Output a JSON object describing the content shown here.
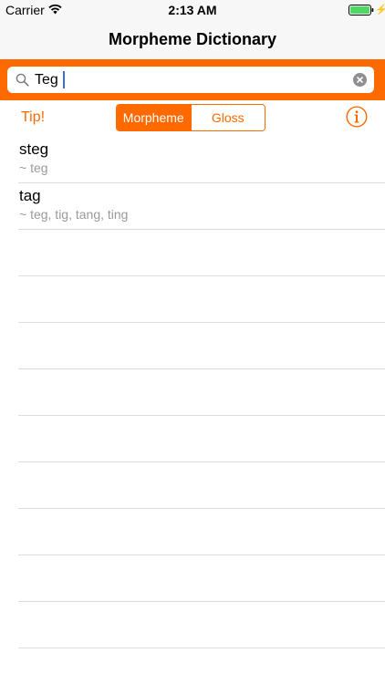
{
  "status_bar": {
    "carrier": "Carrier",
    "time": "2:13 AM",
    "battery_level": 1.0,
    "icons": [
      "wifi-icon",
      "battery-icon",
      "charging-icon"
    ]
  },
  "nav": {
    "title": "Morpheme Dictionary"
  },
  "search": {
    "value": "Teg",
    "icon": "search-icon",
    "clear_icon": "clear-icon"
  },
  "toolbar": {
    "tip_label": "Tip!",
    "segments": [
      {
        "label": "Morpheme",
        "selected": true
      },
      {
        "label": "Gloss",
        "selected": false
      }
    ],
    "info_icon": "info-icon"
  },
  "results": [
    {
      "term": "steg",
      "variants": "~ teg"
    },
    {
      "term": "tag",
      "variants": "~ teg, tig, tang, ting"
    }
  ],
  "colors": {
    "accent": "#ff6a00",
    "bar_background": "#f7f7f7",
    "separator": "#dcdcdc",
    "secondary_text": "#9a9a9a"
  }
}
